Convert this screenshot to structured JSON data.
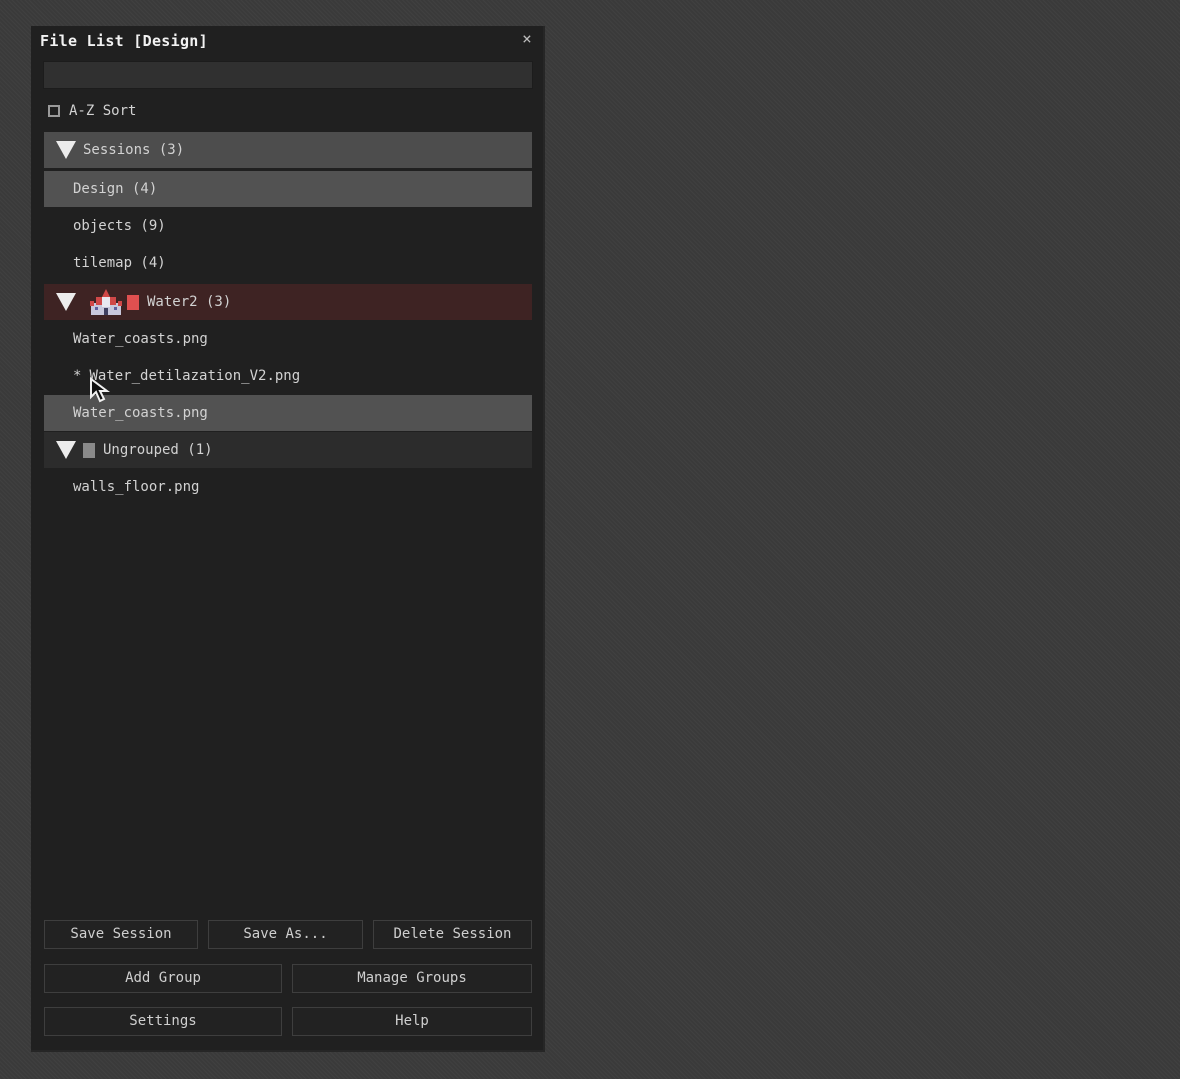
{
  "window": {
    "title": "File List [Design]",
    "close_glyph": "×"
  },
  "search": {
    "value": "",
    "placeholder": ""
  },
  "sort": {
    "label": "A-Z Sort",
    "checked": false
  },
  "sessions": {
    "header": "Sessions (3)",
    "items": [
      "Design (4)",
      "objects (9)",
      "tilemap (4)"
    ],
    "selected_index": 0
  },
  "groups": [
    {
      "header": "Water2 (3)",
      "color": "#e05050",
      "icon": "castle-icon",
      "files": [
        {
          "prefix": "",
          "name": "Water_coasts.png"
        },
        {
          "prefix": "*",
          "name": "Water_detilazation_V2.png"
        },
        {
          "prefix": "",
          "name": "Water_coasts.png"
        }
      ],
      "selected_index": 2
    },
    {
      "header": "Ungrouped (1)",
      "color": "#8a8a8a",
      "files": [
        {
          "prefix": "",
          "name": "walls_floor.png"
        }
      ]
    }
  ],
  "buttons": {
    "save_session": "Save Session",
    "save_as": "Save As...",
    "delete_session": "Delete Session",
    "add_group": "Add Group",
    "manage_groups": "Manage Groups",
    "settings": "Settings",
    "help": "Help"
  },
  "icons": {
    "expand": "triangle-down-icon",
    "close": "close-icon",
    "cursor": "mouse-pointer-icon"
  }
}
